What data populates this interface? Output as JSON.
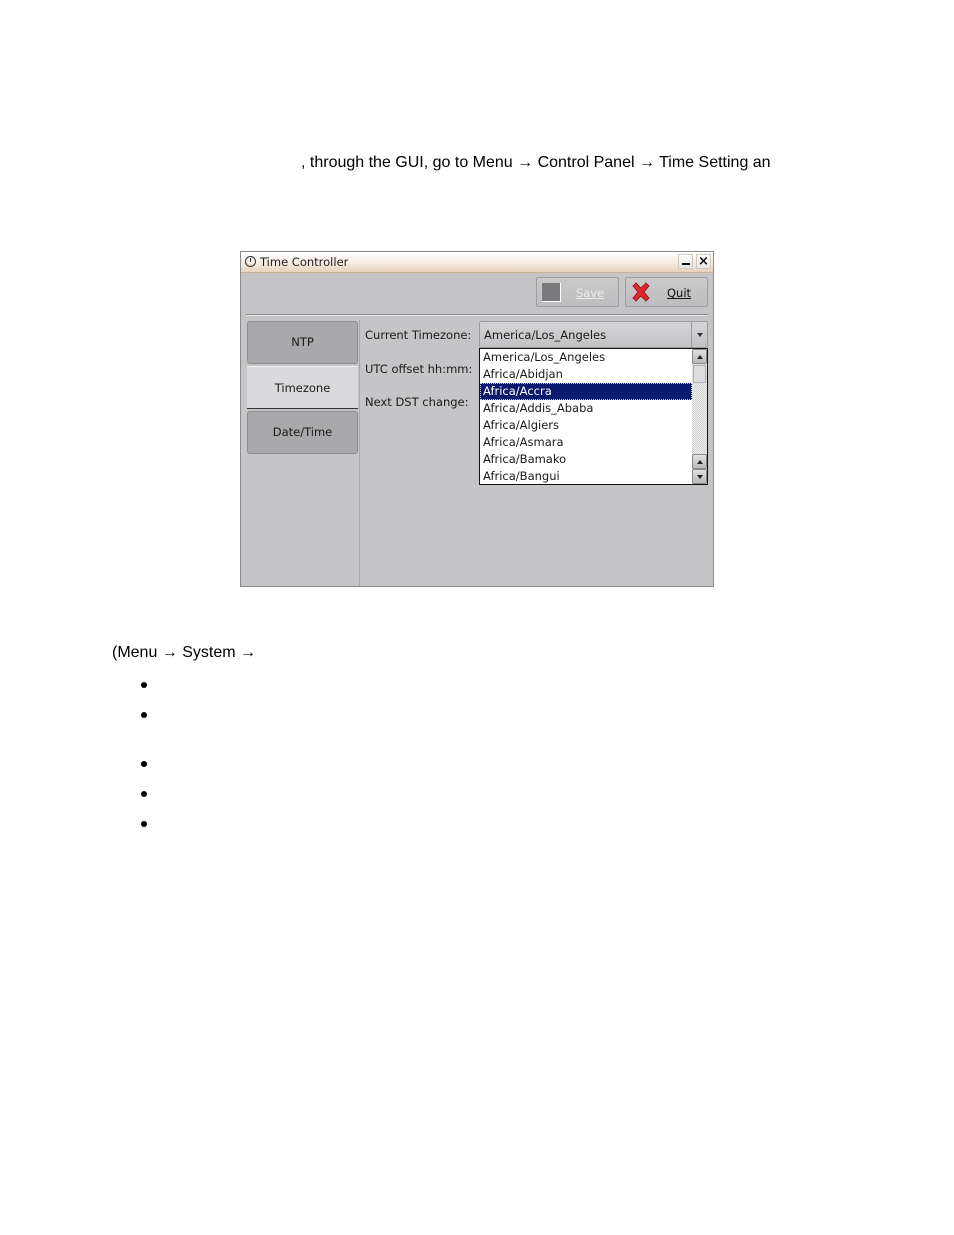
{
  "document": {
    "intro_text": ", through the GUI, go to Menu → Control Panel → Time Setting an",
    "menu_text": "(Menu → System →",
    "bullet_count": 5
  },
  "window": {
    "title": "Time Controller",
    "title_icon": "clock-icon",
    "controls": {
      "minimize_icon": "minimize-icon",
      "close_icon": "close-icon"
    },
    "toolbar": {
      "save_label": "Save",
      "save_enabled": false,
      "quit_label": "Quit",
      "quit_icon": "red-x-icon"
    },
    "tabs": [
      {
        "label": "NTP",
        "active": false
      },
      {
        "label": "Timezone",
        "active": true
      },
      {
        "label": "Date/Time",
        "active": false
      }
    ],
    "timezone_panel": {
      "current_timezone_label": "Current Timezone:",
      "utc_offset_label": "UTC offset hh:mm:",
      "next_dst_label": "Next DST change:",
      "current_timezone_value": "America/Los_Angeles",
      "dropdown_items": [
        "America/Los_Angeles",
        "Africa/Abidjan",
        "Africa/Accra",
        "Africa/Addis_Ababa",
        "Africa/Algiers",
        "Africa/Asmara",
        "Africa/Bamako",
        "Africa/Bangui"
      ],
      "selected_item": "Africa/Accra"
    }
  },
  "colors": {
    "selection_bg": "#0a1a6e",
    "window_bg": "#c5c4c6",
    "quit_icon_red": "#e0262a"
  }
}
